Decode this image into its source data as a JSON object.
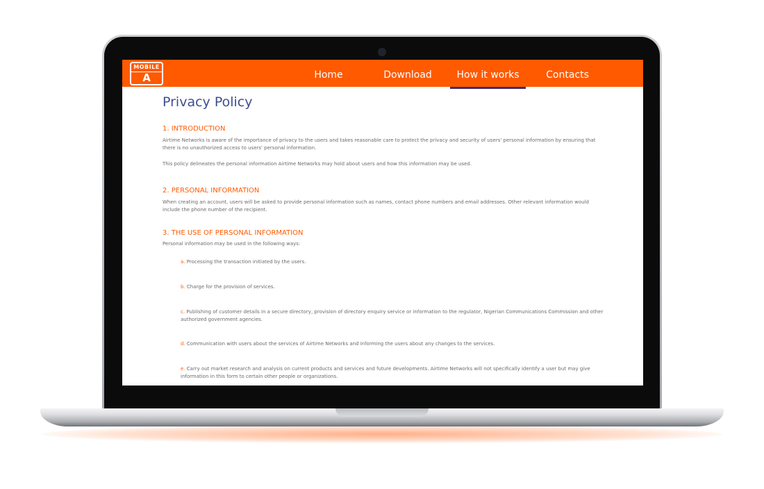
{
  "nav": {
    "logo_top": "MOBILE",
    "logo_bottom": "A",
    "items": [
      {
        "label": "Home"
      },
      {
        "label": "Download"
      },
      {
        "label": "How it works"
      },
      {
        "label": "Contacts"
      }
    ],
    "active_index": 2
  },
  "page": {
    "title": "Privacy Policy",
    "sections": [
      {
        "heading": "1. INTRODUCTION",
        "paragraphs": [
          "Airtime Networks is aware of the importance of privacy to the users and takes reasonable care to protect the privacy and security of users' personal information by ensuring that there is no unauthorized access to users' personal information.",
          "This policy delineates the personal information Airtime Networks may hold about users and how this information may be used."
        ]
      },
      {
        "heading": "2. PERSONAL INFORMATION",
        "paragraphs": [
          "When creating an account, users will be asked to provide personal information such as names, contact phone numbers and email addresses. Other relevant information would include the phone number of the recipient."
        ]
      },
      {
        "heading": "3. THE USE OF PERSONAL INFORMATION",
        "paragraphs": [
          "Personal information may be used in the following ways:"
        ],
        "items": [
          {
            "letter": "a.",
            "text": "Processing the transaction initiated by the users."
          },
          {
            "letter": "b.",
            "text": "Charge for the provision of services."
          },
          {
            "letter": "c.",
            "text": "Publishing of customer details in a secure directory, provision of directory enquiry service or information to the regulator, Nigerian Communications Commission and other authorized government agencies."
          },
          {
            "letter": "d.",
            "text": "Communication with users about the services of Airtime Networks and informing the users about any changes to the services."
          },
          {
            "letter": "e.",
            "text": "Carry out market research and analysis on current products and services and future developments. Airtime Networks will not specifically identify a user but may give information in this form to certain other people or organizations."
          }
        ]
      }
    ]
  },
  "colors": {
    "brand_orange": "#ff5a00",
    "title_blue": "#3f4f8f",
    "active_underline": "#3a2f7a"
  }
}
